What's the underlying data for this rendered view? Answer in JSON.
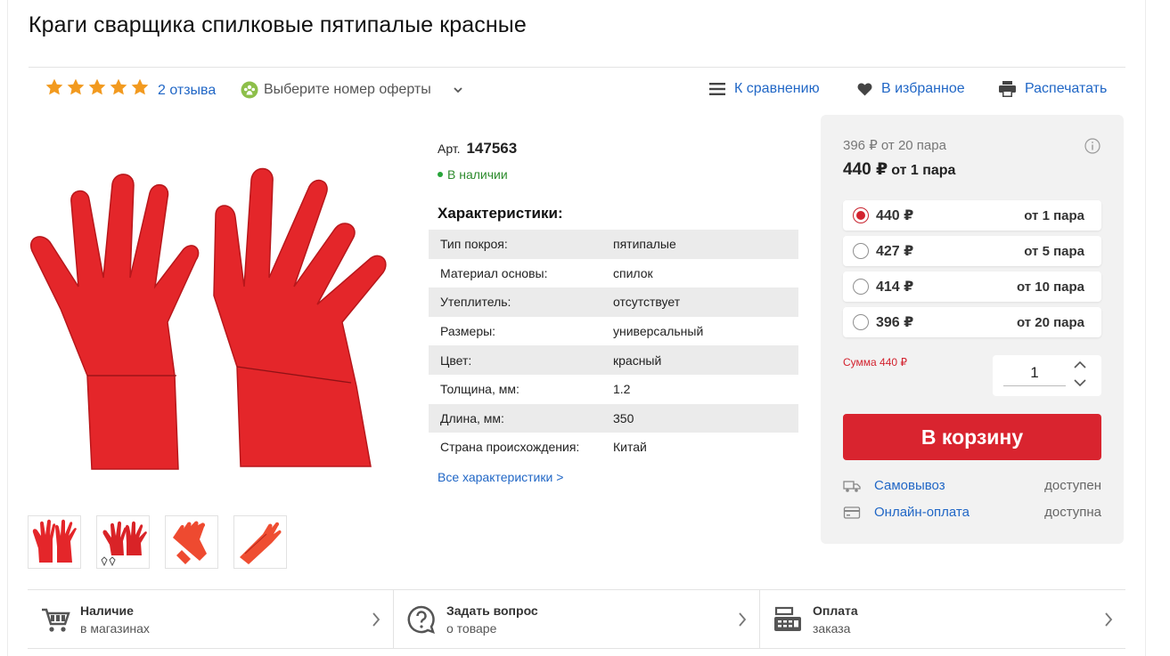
{
  "product": {
    "title": "Краги сварщика спилковые пятипалые красные",
    "rating_stars": 5,
    "reviews_label": "2 отзыва",
    "offer_select_label": "Выберите номер оферты",
    "article_label": "Арт.",
    "article_number": "147563",
    "stock_status": "В наличии"
  },
  "toolbar": {
    "compare_label": "К сравнению",
    "favorites_label": "В избранное",
    "print_label": "Распечатать"
  },
  "characteristics": {
    "title": "Характеристики:",
    "rows": [
      {
        "name": "Тип покроя:",
        "value": "пятипалые"
      },
      {
        "name": "Материал основы:",
        "value": "спилок"
      },
      {
        "name": "Утеплитель:",
        "value": "отсутствует"
      },
      {
        "name": "Размеры:",
        "value": "универсальный"
      },
      {
        "name": "Цвет:",
        "value": "красный"
      },
      {
        "name": "Толщина, мм:",
        "value": "1.2"
      },
      {
        "name": "Длина, мм:",
        "value": "350"
      },
      {
        "name": "Страна происхождения:",
        "value": "Китай"
      }
    ],
    "all_link": "Все характеристики >"
  },
  "pricing": {
    "min_price_text": "396 ₽ от 20 пара",
    "current_price": "440 ₽",
    "current_price_from": "от 1 пара",
    "options": [
      {
        "price": "440 ₽",
        "from": "от 1 пара",
        "selected": true
      },
      {
        "price": "427 ₽",
        "from": "от 5 пара",
        "selected": false
      },
      {
        "price": "414 ₽",
        "from": "от 10 пара",
        "selected": false
      },
      {
        "price": "396 ₽",
        "from": "от 20 пара",
        "selected": false
      }
    ],
    "sum_text": "Сумма 440 ₽",
    "quantity": "1",
    "cart_button": "В корзину",
    "delivery": [
      {
        "label": "Самовывоз",
        "status": "доступен",
        "icon": "truck-icon"
      },
      {
        "label": "Онлайн-оплата",
        "status": "доступна",
        "icon": "card-icon"
      }
    ]
  },
  "bottom_bar": [
    {
      "title": "Наличие",
      "subtitle": "в магазинах",
      "icon": "cart-icon"
    },
    {
      "title": "Задать вопрос",
      "subtitle": "о товаре",
      "icon": "question-icon"
    },
    {
      "title": "Оплата",
      "subtitle": "заказа",
      "icon": "cash-register-icon"
    }
  ],
  "colors": {
    "accent_red": "#d9242f",
    "link_blue": "#2167c6",
    "star_orange": "#f29a1f",
    "stock_green": "#27a43a",
    "panel_gray": "#f2f2f2"
  }
}
